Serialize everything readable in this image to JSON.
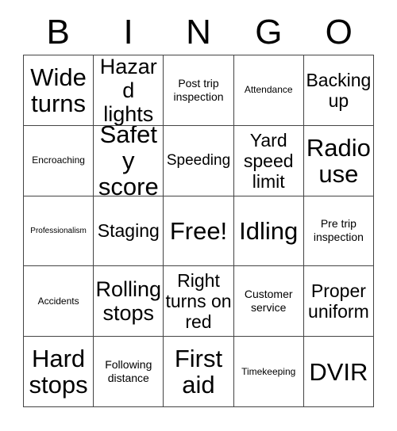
{
  "card": {
    "title": "BINGO",
    "header_letters": [
      "B",
      "I",
      "N",
      "G",
      "O"
    ],
    "columns": 5,
    "rows": 5,
    "colors": {
      "background": "#ffffff",
      "grid_line": "#444444",
      "text": "#000000"
    },
    "free_space": {
      "row": 3,
      "column": 3,
      "label": "Free!"
    },
    "cells": [
      {
        "label": "Wide turns",
        "size": "xxl"
      },
      {
        "label": "Hazard lights",
        "size": "xl"
      },
      {
        "label": "Post trip inspection",
        "size": "sm"
      },
      {
        "label": "Attendance",
        "size": "xs"
      },
      {
        "label": "Backing up",
        "size": "lg"
      },
      {
        "label": "Encroaching",
        "size": "xs"
      },
      {
        "label": "Safety score",
        "size": "xxl"
      },
      {
        "label": "Speeding",
        "size": "md"
      },
      {
        "label": "Yard speed limit",
        "size": "lg"
      },
      {
        "label": "Radio use",
        "size": "xxl"
      },
      {
        "label": "Professionalism",
        "size": "xxs"
      },
      {
        "label": "Staging",
        "size": "lg"
      },
      {
        "label": "Free!",
        "size": "xxl"
      },
      {
        "label": "Idling",
        "size": "xxl"
      },
      {
        "label": "Pre trip inspection",
        "size": "sm"
      },
      {
        "label": "Accidents",
        "size": "xs"
      },
      {
        "label": "Rolling stops",
        "size": "xl"
      },
      {
        "label": "Right turns on red",
        "size": "lg"
      },
      {
        "label": "Customer service",
        "size": "sm"
      },
      {
        "label": "Proper uniform",
        "size": "lg"
      },
      {
        "label": "Hard stops",
        "size": "xxl"
      },
      {
        "label": "Following distance",
        "size": "sm"
      },
      {
        "label": "First aid",
        "size": "xxl"
      },
      {
        "label": "Timekeeping",
        "size": "xs"
      },
      {
        "label": "DVIR",
        "size": "xxl"
      }
    ]
  }
}
